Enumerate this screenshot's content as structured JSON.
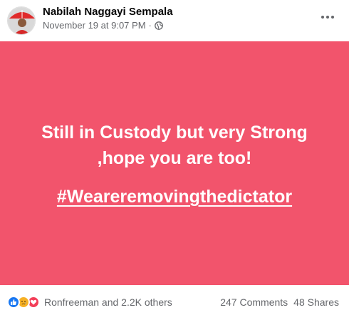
{
  "post": {
    "author": "Nabilah Naggayi Sempala",
    "timestamp": "November 19 at 9:07 PM",
    "separator": "·",
    "privacy_icon": "globe-icon",
    "more_icon": "more-options-icon",
    "background_color": "#f2546c",
    "text_line_1": "Still in Custody but very Strong",
    "text_line_2": ",hope you are too!",
    "hashtag": "#Weareremovingthedictator"
  },
  "footer": {
    "reaction_icons": [
      "like-icon",
      "sad-icon",
      "love-icon"
    ],
    "reactors": "Ronfreeman and 2.2K others",
    "comments": "247 Comments",
    "shares": "48 Shares"
  },
  "colors": {
    "like": "#1877f2",
    "sad": "#f7b125",
    "love": "#f33e58",
    "secondary_text": "#65676b"
  }
}
